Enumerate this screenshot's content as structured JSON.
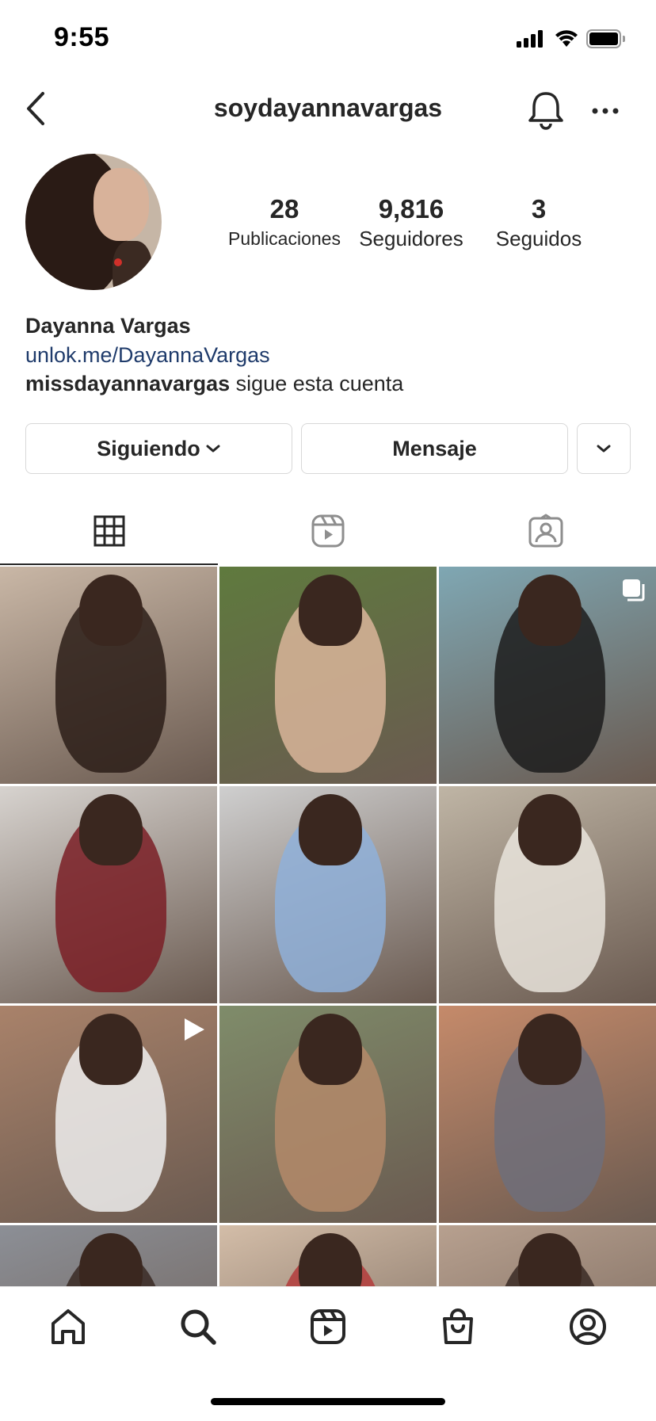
{
  "status_bar": {
    "time": "9:55"
  },
  "header": {
    "username": "soydayannavargas"
  },
  "profile": {
    "stats": [
      {
        "value": "28",
        "label": "Publicaciones"
      },
      {
        "value": "9,816",
        "label": "Seguidores"
      },
      {
        "value": "3",
        "label": "Seguidos"
      }
    ],
    "full_name": "Dayanna Vargas",
    "link": "unlok.me/DayannaVargas",
    "followed_by_user": "missdayannavargas",
    "followed_by_text": " sigue esta cuenta"
  },
  "actions": {
    "following_label": "Siguiendo",
    "message_label": "Mensaje"
  },
  "tabs": [
    "grid-icon",
    "reels-icon",
    "tagged-icon"
  ],
  "grid_posts": [
    {
      "bg": "#c9b7a6",
      "fig": "#2b1d17",
      "badge": ""
    },
    {
      "bg": "#5f7a3e",
      "fig": "#d9b59a",
      "badge": ""
    },
    {
      "bg": "#7fa7b3",
      "fig": "#1c1c1c",
      "badge": "carousel"
    },
    {
      "bg": "#d7d3cf",
      "fig": "#7a1f26",
      "badge": ""
    },
    {
      "bg": "#cfcfcf",
      "fig": "#8fb0d9",
      "badge": ""
    },
    {
      "bg": "#bfb5a5",
      "fig": "#e9e4dc",
      "badge": ""
    },
    {
      "bg": "#a9826a",
      "fig": "#efefef",
      "badge": "video"
    },
    {
      "bg": "#7f8c6a",
      "fig": "#b48a6a",
      "badge": ""
    },
    {
      "bg": "#c58a6a",
      "fig": "#6f6f7a",
      "badge": ""
    },
    {
      "bg": "#8c8f96",
      "fig": "#3a2a24",
      "badge": ""
    },
    {
      "bg": "#d3bda8",
      "fig": "#b33b3b",
      "badge": ""
    },
    {
      "bg": "#b7a08f",
      "fig": "#3a2a24",
      "badge": ""
    }
  ],
  "bottom_nav": [
    "home-icon",
    "search-icon",
    "reels-icon",
    "shop-icon",
    "profile-icon"
  ]
}
